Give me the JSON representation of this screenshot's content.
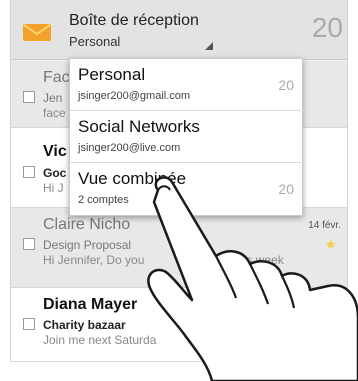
{
  "header": {
    "title": "Boîte de réception",
    "account": "Personal",
    "unread_count": "20"
  },
  "messages": [
    {
      "sender": "Fac",
      "subject": "Jen",
      "snippet": "face",
      "date": "",
      "starred": false,
      "state": "read"
    },
    {
      "sender": "Vic",
      "subject": "Goc",
      "snippet": "Hi J",
      "date": "",
      "starred": false,
      "state": "unread"
    },
    {
      "sender": "Claire Nicho",
      "subject": "Design Proposal",
      "snippet": "Hi Jennifer, Do you",
      "snippet_tail": "time this week",
      "date": "14 févr.",
      "starred": true,
      "state": "read"
    },
    {
      "sender": "Diana Mayer",
      "subject": "Charity bazaar",
      "snippet": "Join me next Saturda",
      "date": "",
      "starred": false,
      "state": "unread"
    }
  ],
  "account_menu": {
    "items": [
      {
        "name": "Personal",
        "detail": "jsinger200@gmail.com",
        "count": "20"
      },
      {
        "name": "Social Networks",
        "detail": "jsinger200@live.com",
        "count": ""
      },
      {
        "name": "Vue combinée",
        "detail": "2 comptes",
        "count": "20"
      }
    ]
  },
  "colors": {
    "accent_star": "#f3d14e",
    "action_bar": "#e3e3e3",
    "app_icon_orange": "#f3a12a"
  },
  "icons": {
    "app": "mail-envelope-icon",
    "caret": "dropdown-caret-icon",
    "star": "star-icon",
    "hand": "pointing-hand-icon"
  }
}
